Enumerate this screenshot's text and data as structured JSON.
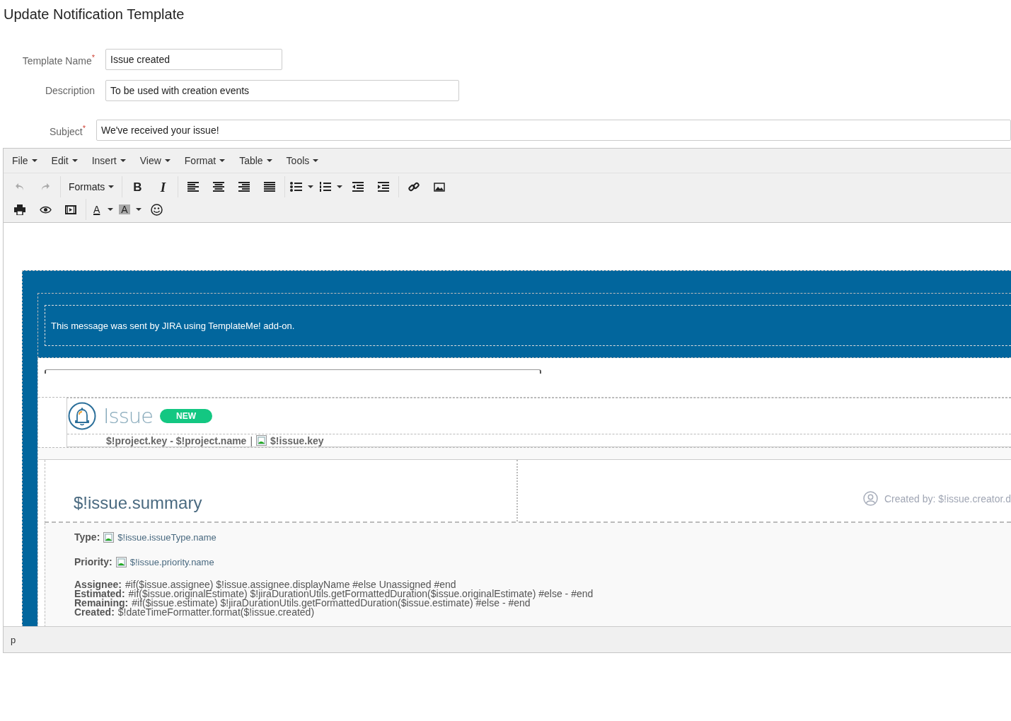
{
  "title": "Update Notification Template",
  "fields": [
    {
      "label": "Template Name",
      "required_mark": "*",
      "value": "Issue created"
    },
    {
      "label": "Description",
      "value": "To be used with creation events"
    },
    {
      "label": "Subject",
      "required_mark": "*",
      "value": "We've received your issue!"
    }
  ],
  "editor": {
    "menu": [
      "File",
      "Edit",
      "Insert",
      "View",
      "Format",
      "Table",
      "Tools"
    ],
    "toolbar": [
      [
        [
          {
            "kind": "undo",
            "disabled": true
          },
          {
            "kind": "redo",
            "disabled": true
          }
        ],
        [
          {
            "kind": "formats",
            "label": "Formats"
          }
        ],
        [
          {
            "kind": "bold",
            "glyph": "B"
          },
          {
            "kind": "italic",
            "glyph": "I"
          }
        ],
        [
          {
            "kind": "align-left"
          },
          {
            "kind": "align-center"
          },
          {
            "kind": "align-right"
          },
          {
            "kind": "align-justify"
          }
        ],
        [
          {
            "kind": "bullet-list"
          },
          {
            "kind": "numbered-list"
          },
          {
            "kind": "outdent"
          },
          {
            "kind": "indent"
          }
        ],
        [
          {
            "kind": "link"
          },
          {
            "kind": "image"
          }
        ]
      ],
      [
        [
          {
            "kind": "print"
          },
          {
            "kind": "preview"
          },
          {
            "kind": "media"
          }
        ],
        [
          {
            "kind": "text-color",
            "glyph": "A"
          },
          {
            "kind": "background-color",
            "glyph": "A"
          },
          {
            "kind": "emoticon"
          }
        ]
      ]
    ],
    "content": {
      "banner": "This message was sent by JIRA using TemplateMe! add-on.",
      "heading": "Issue",
      "badge": "NEW",
      "project_line": {
        "project": "$!project.key - $!project.name",
        "separator": "|",
        "key": "$!issue.key"
      },
      "summary": "$!issue.summary",
      "created_by": "Created by: $!issue.creator.d",
      "details": [
        {
          "kind": "icon-line",
          "label": "Type:",
          "value": "$!issue.issueType.name"
        },
        {
          "kind": "icon-line",
          "label": "Priority:",
          "value": "$!issue.priority.name"
        },
        {
          "kind": "line",
          "label": "Assignee:",
          "value": "#if($issue.assignee) $!issue.assignee.displayName #else Unassigned #end"
        },
        {
          "kind": "line",
          "label": "Estimated:",
          "value": "#if($issue.originalEstimate) $!jiraDurationUtils.getFormattedDuration($issue.originalEstimate) #else - #end"
        },
        {
          "kind": "line",
          "label": "Remaining:",
          "value": "#if($issue.estimate) $!jiraDurationUtils.getFormattedDuration($issue.estimate) #else - #end"
        },
        {
          "kind": "line",
          "label": "Created:",
          "value": "$!dateTimeFormatter.format($!issue.created)"
        }
      ]
    },
    "status_bar": "p"
  }
}
